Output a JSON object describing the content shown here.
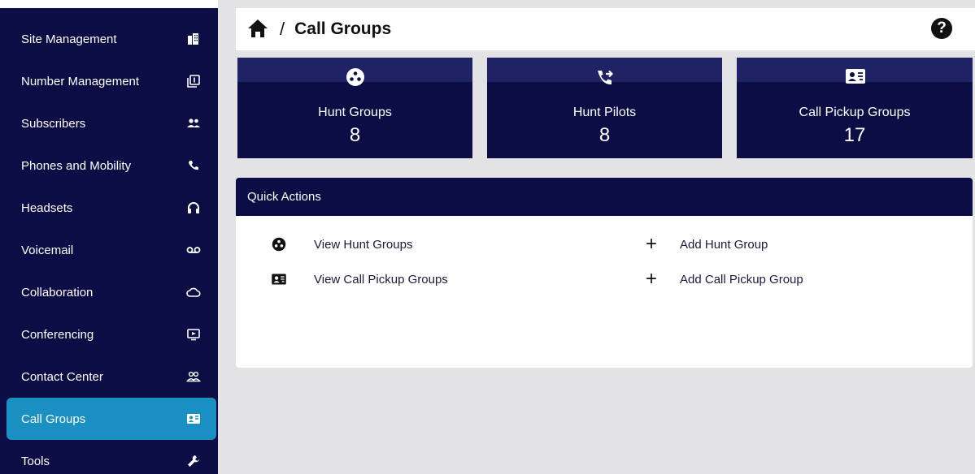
{
  "sidebar": {
    "items": [
      {
        "label": "Site Management",
        "icon": "building-icon"
      },
      {
        "label": "Number Management",
        "icon": "number-box-icon"
      },
      {
        "label": "Subscribers",
        "icon": "people-icon"
      },
      {
        "label": "Phones and Mobility",
        "icon": "phone-icon"
      },
      {
        "label": "Headsets",
        "icon": "headset-icon"
      },
      {
        "label": "Voicemail",
        "icon": "voicemail-icon"
      },
      {
        "label": "Collaboration",
        "icon": "cloud-icon"
      },
      {
        "label": "Conferencing",
        "icon": "presentation-icon"
      },
      {
        "label": "Contact Center",
        "icon": "group-outline-icon"
      },
      {
        "label": "Call Groups",
        "icon": "contact-card-icon",
        "active": true
      },
      {
        "label": "Tools",
        "icon": "wrench-icon"
      }
    ]
  },
  "header": {
    "separator": "/",
    "title": "Call Groups",
    "help": "?"
  },
  "cards": [
    {
      "name": "Hunt Groups",
      "value": "8",
      "icon": "hunt-group-icon"
    },
    {
      "name": "Hunt Pilots",
      "value": "8",
      "icon": "phone-forward-icon"
    },
    {
      "name": "Call Pickup Groups",
      "value": "17",
      "icon": "contact-card-icon"
    }
  ],
  "quick_actions": {
    "title": "Quick Actions",
    "links": [
      {
        "label": "View Hunt Groups",
        "icon": "hunt-group-icon"
      },
      {
        "label": "View Call Pickup Groups",
        "icon": "contact-card-icon"
      },
      {
        "label": "Add Hunt Group",
        "icon": "plus-icon"
      },
      {
        "label": "Add Call Pickup Group",
        "icon": "plus-icon"
      }
    ],
    "plus_symbol": "+"
  },
  "colors": {
    "navy": "#0b0d44",
    "active": "#1a8fc1",
    "background": "#e3e3e6"
  }
}
